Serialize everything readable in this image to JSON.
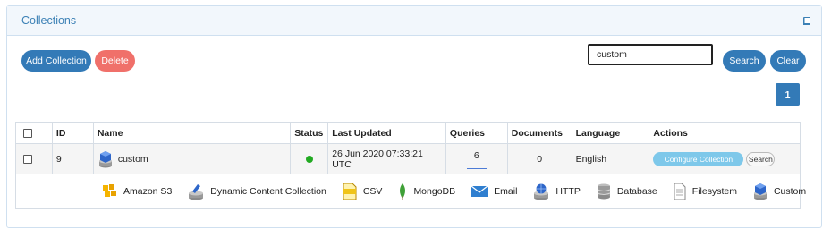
{
  "panel": {
    "title": "Collections",
    "header_icon": "book-icon"
  },
  "toolbar": {
    "add_label": "Add Collection",
    "delete_label": "Delete",
    "search_value": "custom",
    "search_label": "Search",
    "clear_label": "Clear"
  },
  "pagination": {
    "current_page": "1"
  },
  "table": {
    "columns": [
      "",
      "ID",
      "Name",
      "Status",
      "Last Updated",
      "Queries",
      "Documents",
      "Language",
      "Actions"
    ],
    "rows": [
      {
        "id": "9",
        "name": "custom",
        "type_icon": "custom-icon",
        "status_color": "#22aa22",
        "last_updated": "26 Jun 2020 07:33:21 UTC",
        "queries": "6",
        "documents": "0",
        "language": "English",
        "configure_label": "Configure Collection",
        "search_label": "Search"
      }
    ]
  },
  "legend": [
    {
      "label": "Amazon S3",
      "icon": "amazon-s3-icon"
    },
    {
      "label": "Dynamic Content Collection",
      "icon": "dynamic-content-icon"
    },
    {
      "label": "CSV",
      "icon": "csv-icon"
    },
    {
      "label": "MongoDB",
      "icon": "mongodb-icon"
    },
    {
      "label": "Email",
      "icon": "email-icon"
    },
    {
      "label": "HTTP",
      "icon": "http-icon"
    },
    {
      "label": "Database",
      "icon": "database-icon"
    },
    {
      "label": "Filesystem",
      "icon": "filesystem-icon"
    },
    {
      "label": "Custom",
      "icon": "custom-icon"
    }
  ],
  "colors": {
    "primary": "#337ab7",
    "danger": "#f0706a",
    "configure": "#7ec8ea",
    "heading_text": "#3b80b5"
  }
}
